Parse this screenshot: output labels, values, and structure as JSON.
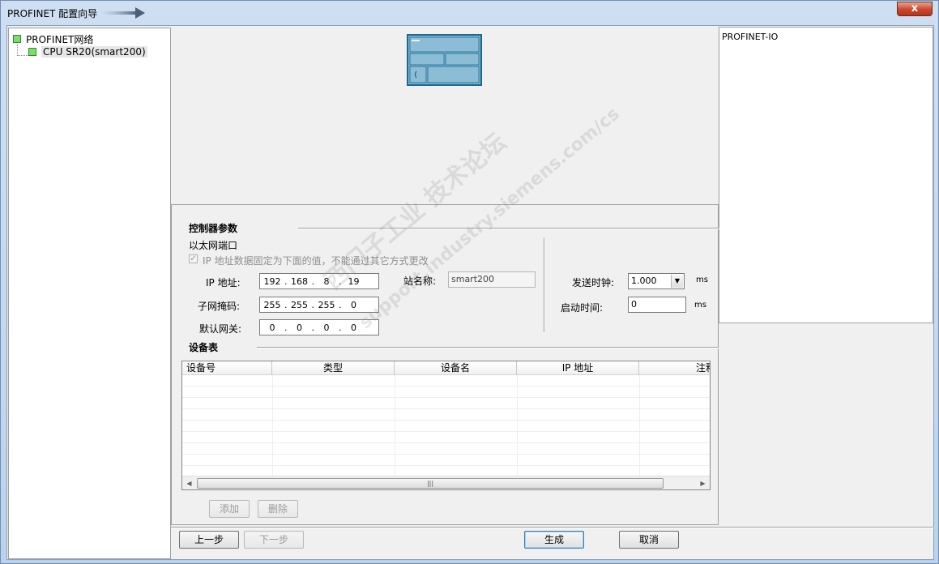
{
  "window": {
    "title": "PROFINET 配置向导",
    "close_glyph": "x"
  },
  "tree": {
    "root": "PROFINET网络",
    "child": "CPU SR20(smart200)"
  },
  "right_panel": {
    "title": "PROFINET-IO"
  },
  "controller": {
    "section_title": "控制器参数",
    "ethernet_port": "以太网端口",
    "fixed_ip_label": "IP 地址数据固定为下面的值，不能通过其它方式更改",
    "fixed_ip_checked": true,
    "ip_label": "IP 地址:",
    "ip": [
      "192",
      "168",
      "8",
      "19"
    ],
    "subnet_label": "子网掩码:",
    "subnet": [
      "255",
      "255",
      "255",
      "0"
    ],
    "gateway_label": "默认网关:",
    "gateway": [
      "0",
      "0",
      "0",
      "0"
    ],
    "station_label": "站名称:",
    "station_name": "smart200",
    "send_clock_label": "发送时钟:",
    "send_clock_value": "1.000",
    "send_clock_unit": "ms",
    "startup_label": "启动时间:",
    "startup_value": "0",
    "startup_unit": "ms"
  },
  "device_table": {
    "section_title": "设备表",
    "columns": [
      "设备号",
      "类型",
      "设备名",
      "IP 地址",
      "注释"
    ],
    "rows": []
  },
  "buttons": {
    "add": "添加",
    "delete": "删除",
    "prev": "上一步",
    "next": "下一步",
    "generate": "生成",
    "cancel": "取消"
  },
  "watermark": {
    "line1": "西门子工业 技术论坛",
    "line2": "support.industry.siemens.com/cs"
  }
}
